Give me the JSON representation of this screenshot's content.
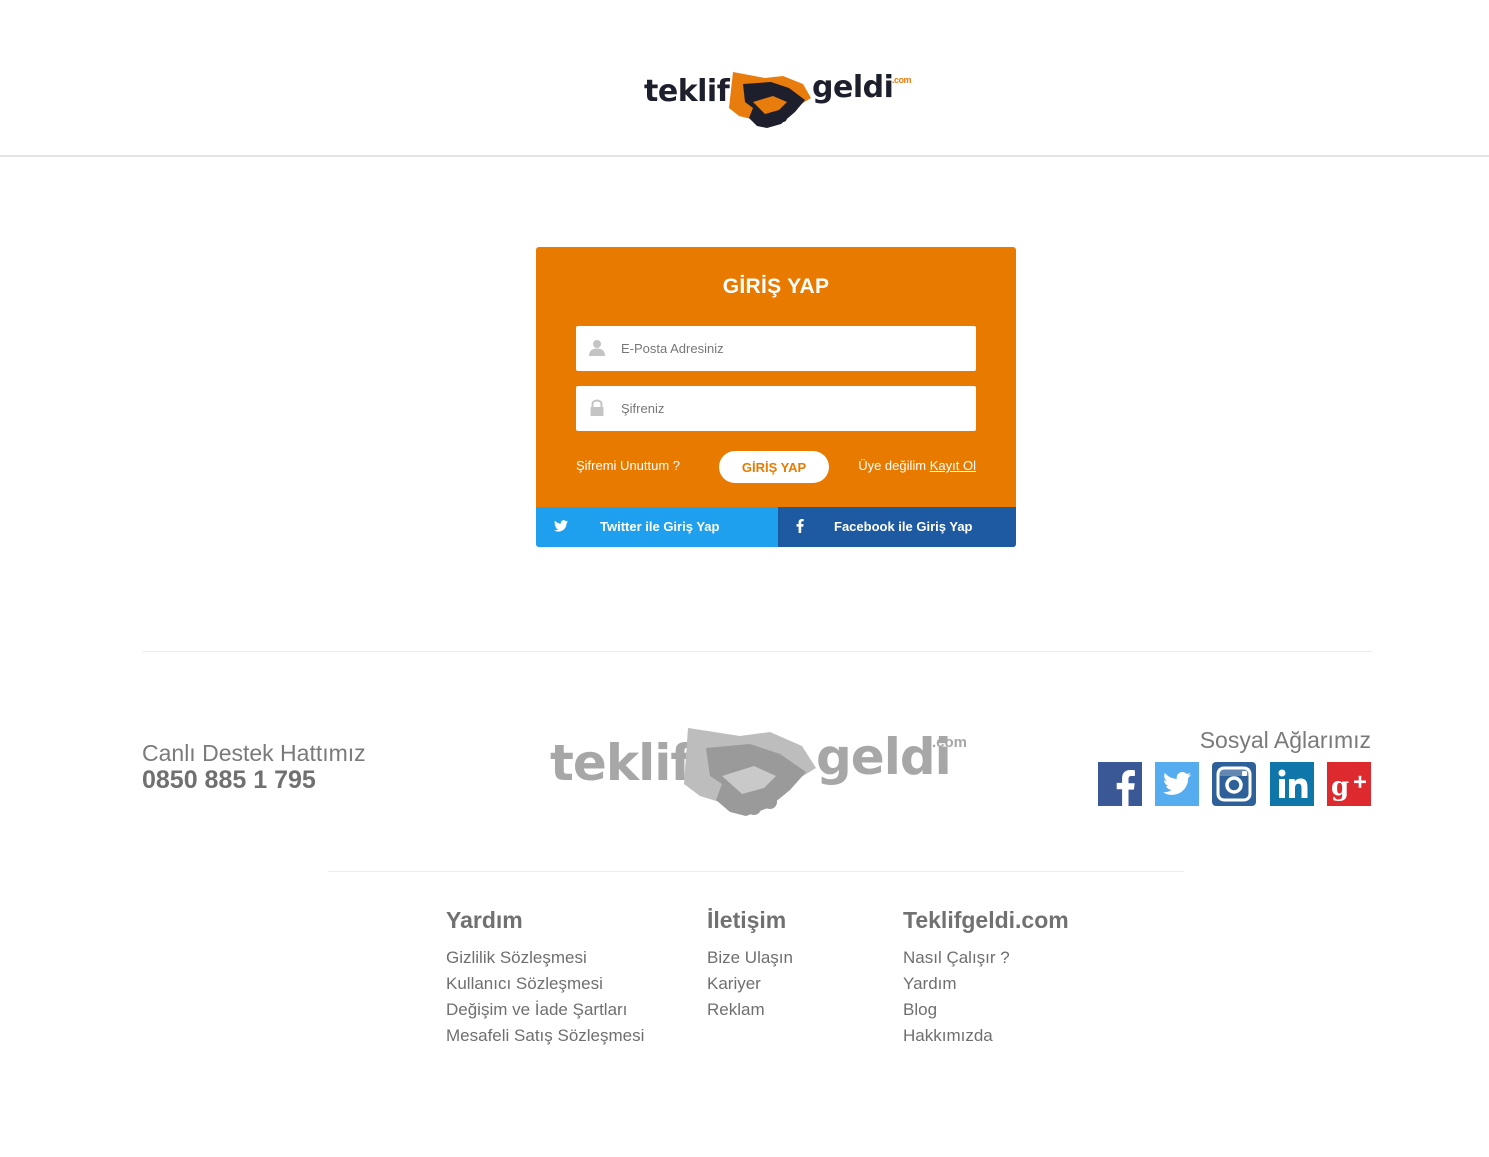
{
  "header": {
    "logo": {
      "word1": "teklif",
      "word2": "geldi",
      "suffix": ".com"
    }
  },
  "login": {
    "title": "GİRİŞ YAP",
    "email_placeholder": "E-Posta Adresiniz",
    "password_placeholder": "Şifreniz",
    "forgot_label": "Şifremi Unuttum ?",
    "submit_label": "GİRİŞ YAP",
    "not_member_label": "Üye değilim",
    "register_label": "Kayıt Ol",
    "twitter_label": "Twitter ile Giriş Yap",
    "facebook_label": "Facebook ile Giriş Yap"
  },
  "footer": {
    "support_label": "Canlı Destek Hattımız",
    "support_phone": "0850 885 1 795",
    "logo": {
      "word1": "teklif",
      "word2": "geldi",
      "suffix": ".com"
    },
    "social_title": "Sosyal Ağlarımız",
    "social_icons": [
      "facebook-icon",
      "twitter-icon",
      "instagram-icon",
      "linkedin-icon",
      "google-plus-icon"
    ],
    "columns": [
      {
        "title": "Yardım",
        "links": [
          "Gizlilik Sözleşmesi",
          "Kullanıcı Sözleşmesi",
          "Değişim ve İade Şartları",
          "Mesafeli Satış Sözleşmesi"
        ]
      },
      {
        "title": "İletişim",
        "links": [
          "Bize Ulaşın",
          "Kariyer",
          "Reklam"
        ]
      },
      {
        "title": "Teklifgeldi.com",
        "links": [
          "Nasıl Çalışır ?",
          "Yardım",
          "Blog",
          "Hakkımızda"
        ]
      }
    ]
  },
  "colors": {
    "brand_orange": "#e87a00",
    "twitter_blue": "#1ea0ee",
    "facebook_blue": "#1e5aa2",
    "facebook_icon": "#3a5896",
    "twitter_icon": "#55acee",
    "instagram_icon": "#2e6199",
    "linkedin_icon": "#0e76a8",
    "google_plus_icon": "#dc2a2e"
  }
}
